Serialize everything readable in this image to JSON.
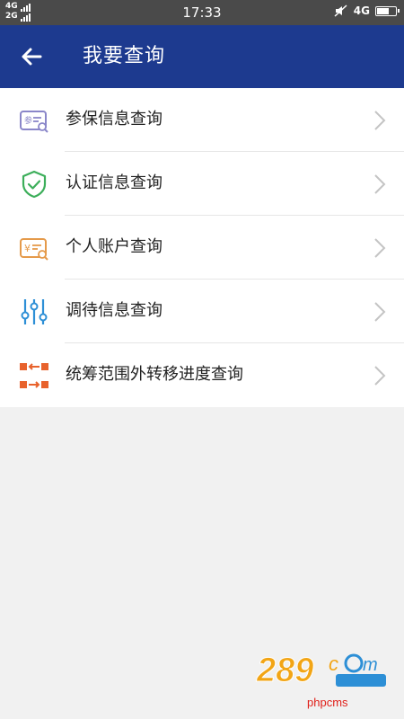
{
  "status_bar": {
    "network_top": "4G",
    "network_bottom": "2G",
    "time": "17:33",
    "network_right": "4G"
  },
  "header": {
    "title": "我要查询"
  },
  "menu": {
    "items": [
      {
        "label": "参保信息查询",
        "icon": "insurance-card-search-icon",
        "color": "#8a86c9"
      },
      {
        "label": "认证信息查询",
        "icon": "shield-check-icon",
        "color": "#3cae5a"
      },
      {
        "label": "个人账户查询",
        "icon": "yuan-card-search-icon",
        "color": "#e59a4a"
      },
      {
        "label": "调待信息查询",
        "icon": "sliders-icon",
        "color": "#2d8fd6"
      },
      {
        "label": "统筹范围外转移进度查询",
        "icon": "transfer-arrows-icon",
        "color": "#e8622c"
      }
    ]
  },
  "watermark": {
    "logo_text": "289",
    "caption": "phpcms"
  },
  "colors": {
    "header_bg": "#1d3a8f",
    "status_bg": "#4a4a4a",
    "page_bg": "#f1f1f1"
  }
}
